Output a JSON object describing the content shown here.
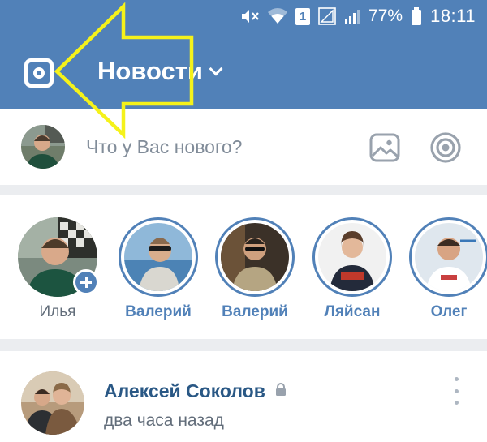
{
  "status_bar": {
    "battery_percent": "77%",
    "time": "18:11",
    "sim_slot": "1",
    "icons": [
      "mute-icon",
      "wifi-icon",
      "sim-icon",
      "signal-empty-icon",
      "signal-icon",
      "battery-icon"
    ]
  },
  "header": {
    "title": "Новости",
    "camera_icon": "camera-icon",
    "dropdown_icon": "chevron-down-icon",
    "background_color": "#5181b8"
  },
  "annotation": {
    "type": "yellow-arrow-pointing-left",
    "color": "#f5f21a"
  },
  "composer": {
    "placeholder": "Что у Вас нового?",
    "photo_icon": "photo-icon",
    "story_icon": "story-target-icon"
  },
  "stories": [
    {
      "name": "Илья",
      "own": true,
      "badge_icon": "plus-icon"
    },
    {
      "name": "Валерий",
      "own": false
    },
    {
      "name": "Валерий",
      "own": false
    },
    {
      "name": "Ляйсан",
      "own": false
    },
    {
      "name": "Олег",
      "own": false
    }
  ],
  "post": {
    "author": "Алексей Соколов",
    "time": "два часа назад",
    "lock_icon": "lock-icon",
    "more_icon": "more-vertical-icon"
  },
  "colors": {
    "accent": "#5181b8",
    "link": "#2a5885",
    "secondary_text": "#818c99",
    "page_bg": "#ebedf0"
  }
}
